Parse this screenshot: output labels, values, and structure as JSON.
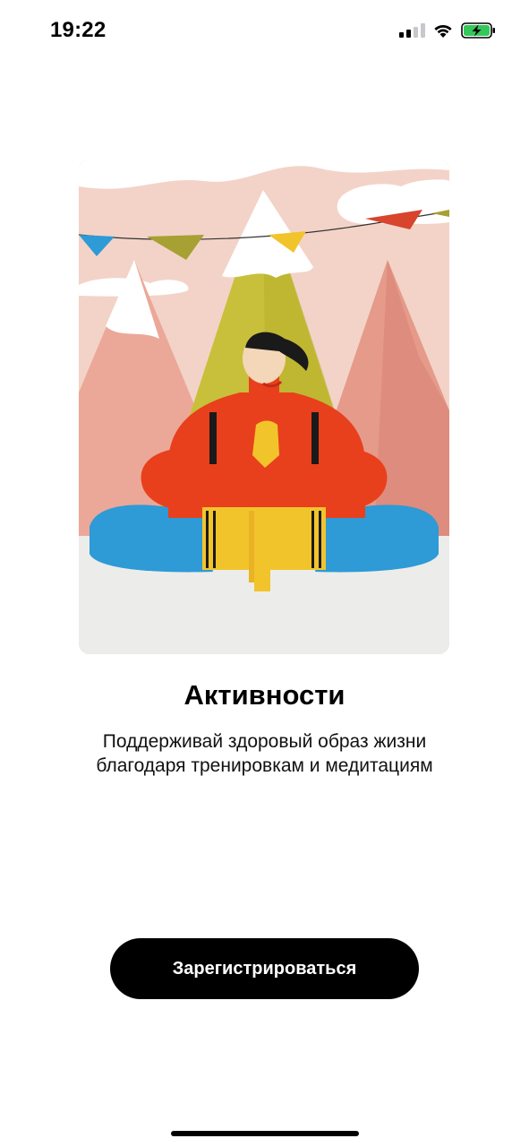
{
  "status_bar": {
    "time": "19:22",
    "icons": [
      "cellular-signal-icon",
      "wifi-icon",
      "battery-charging-icon"
    ],
    "battery_color": "#34c759"
  },
  "onboarding": {
    "illustration": "person-meditating-mountains-illustration",
    "title": "Активности",
    "subtitle_line1": "Поддерживай здоровый образ жизни",
    "subtitle_line2": "благодаря тренировкам и медитациям"
  },
  "actions": {
    "register_label": "Зарегистрироваться"
  },
  "colors": {
    "button_bg": "#000000",
    "button_text": "#ffffff",
    "illustration_sky": "#f4d6cc",
    "sweater": "#e8401c",
    "pants": "#2e9ad6",
    "mountain_green": "#c9c23a"
  }
}
